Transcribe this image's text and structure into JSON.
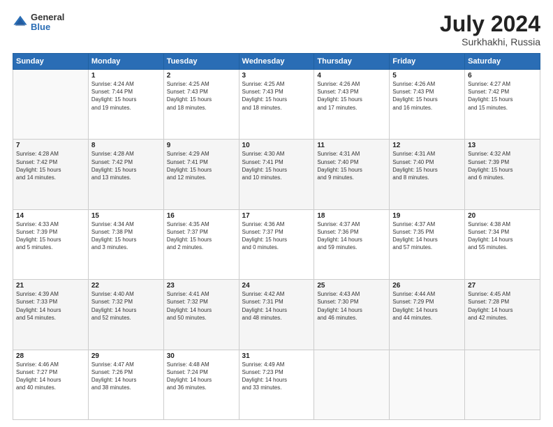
{
  "logo": {
    "general": "General",
    "blue": "Blue"
  },
  "title": {
    "month": "July 2024",
    "location": "Surkhakhi, Russia"
  },
  "days_of_week": [
    "Sunday",
    "Monday",
    "Tuesday",
    "Wednesday",
    "Thursday",
    "Friday",
    "Saturday"
  ],
  "weeks": [
    [
      {
        "day": "",
        "info": ""
      },
      {
        "day": "1",
        "info": "Sunrise: 4:24 AM\nSunset: 7:44 PM\nDaylight: 15 hours\nand 19 minutes."
      },
      {
        "day": "2",
        "info": "Sunrise: 4:25 AM\nSunset: 7:43 PM\nDaylight: 15 hours\nand 18 minutes."
      },
      {
        "day": "3",
        "info": "Sunrise: 4:25 AM\nSunset: 7:43 PM\nDaylight: 15 hours\nand 18 minutes."
      },
      {
        "day": "4",
        "info": "Sunrise: 4:26 AM\nSunset: 7:43 PM\nDaylight: 15 hours\nand 17 minutes."
      },
      {
        "day": "5",
        "info": "Sunrise: 4:26 AM\nSunset: 7:43 PM\nDaylight: 15 hours\nand 16 minutes."
      },
      {
        "day": "6",
        "info": "Sunrise: 4:27 AM\nSunset: 7:42 PM\nDaylight: 15 hours\nand 15 minutes."
      }
    ],
    [
      {
        "day": "7",
        "info": "Sunrise: 4:28 AM\nSunset: 7:42 PM\nDaylight: 15 hours\nand 14 minutes."
      },
      {
        "day": "8",
        "info": "Sunrise: 4:28 AM\nSunset: 7:42 PM\nDaylight: 15 hours\nand 13 minutes."
      },
      {
        "day": "9",
        "info": "Sunrise: 4:29 AM\nSunset: 7:41 PM\nDaylight: 15 hours\nand 12 minutes."
      },
      {
        "day": "10",
        "info": "Sunrise: 4:30 AM\nSunset: 7:41 PM\nDaylight: 15 hours\nand 10 minutes."
      },
      {
        "day": "11",
        "info": "Sunrise: 4:31 AM\nSunset: 7:40 PM\nDaylight: 15 hours\nand 9 minutes."
      },
      {
        "day": "12",
        "info": "Sunrise: 4:31 AM\nSunset: 7:40 PM\nDaylight: 15 hours\nand 8 minutes."
      },
      {
        "day": "13",
        "info": "Sunrise: 4:32 AM\nSunset: 7:39 PM\nDaylight: 15 hours\nand 6 minutes."
      }
    ],
    [
      {
        "day": "14",
        "info": "Sunrise: 4:33 AM\nSunset: 7:39 PM\nDaylight: 15 hours\nand 5 minutes."
      },
      {
        "day": "15",
        "info": "Sunrise: 4:34 AM\nSunset: 7:38 PM\nDaylight: 15 hours\nand 3 minutes."
      },
      {
        "day": "16",
        "info": "Sunrise: 4:35 AM\nSunset: 7:37 PM\nDaylight: 15 hours\nand 2 minutes."
      },
      {
        "day": "17",
        "info": "Sunrise: 4:36 AM\nSunset: 7:37 PM\nDaylight: 15 hours\nand 0 minutes."
      },
      {
        "day": "18",
        "info": "Sunrise: 4:37 AM\nSunset: 7:36 PM\nDaylight: 14 hours\nand 59 minutes."
      },
      {
        "day": "19",
        "info": "Sunrise: 4:37 AM\nSunset: 7:35 PM\nDaylight: 14 hours\nand 57 minutes."
      },
      {
        "day": "20",
        "info": "Sunrise: 4:38 AM\nSunset: 7:34 PM\nDaylight: 14 hours\nand 55 minutes."
      }
    ],
    [
      {
        "day": "21",
        "info": "Sunrise: 4:39 AM\nSunset: 7:33 PM\nDaylight: 14 hours\nand 54 minutes."
      },
      {
        "day": "22",
        "info": "Sunrise: 4:40 AM\nSunset: 7:32 PM\nDaylight: 14 hours\nand 52 minutes."
      },
      {
        "day": "23",
        "info": "Sunrise: 4:41 AM\nSunset: 7:32 PM\nDaylight: 14 hours\nand 50 minutes."
      },
      {
        "day": "24",
        "info": "Sunrise: 4:42 AM\nSunset: 7:31 PM\nDaylight: 14 hours\nand 48 minutes."
      },
      {
        "day": "25",
        "info": "Sunrise: 4:43 AM\nSunset: 7:30 PM\nDaylight: 14 hours\nand 46 minutes."
      },
      {
        "day": "26",
        "info": "Sunrise: 4:44 AM\nSunset: 7:29 PM\nDaylight: 14 hours\nand 44 minutes."
      },
      {
        "day": "27",
        "info": "Sunrise: 4:45 AM\nSunset: 7:28 PM\nDaylight: 14 hours\nand 42 minutes."
      }
    ],
    [
      {
        "day": "28",
        "info": "Sunrise: 4:46 AM\nSunset: 7:27 PM\nDaylight: 14 hours\nand 40 minutes."
      },
      {
        "day": "29",
        "info": "Sunrise: 4:47 AM\nSunset: 7:26 PM\nDaylight: 14 hours\nand 38 minutes."
      },
      {
        "day": "30",
        "info": "Sunrise: 4:48 AM\nSunset: 7:24 PM\nDaylight: 14 hours\nand 36 minutes."
      },
      {
        "day": "31",
        "info": "Sunrise: 4:49 AM\nSunset: 7:23 PM\nDaylight: 14 hours\nand 33 minutes."
      },
      {
        "day": "",
        "info": ""
      },
      {
        "day": "",
        "info": ""
      },
      {
        "day": "",
        "info": ""
      }
    ]
  ]
}
